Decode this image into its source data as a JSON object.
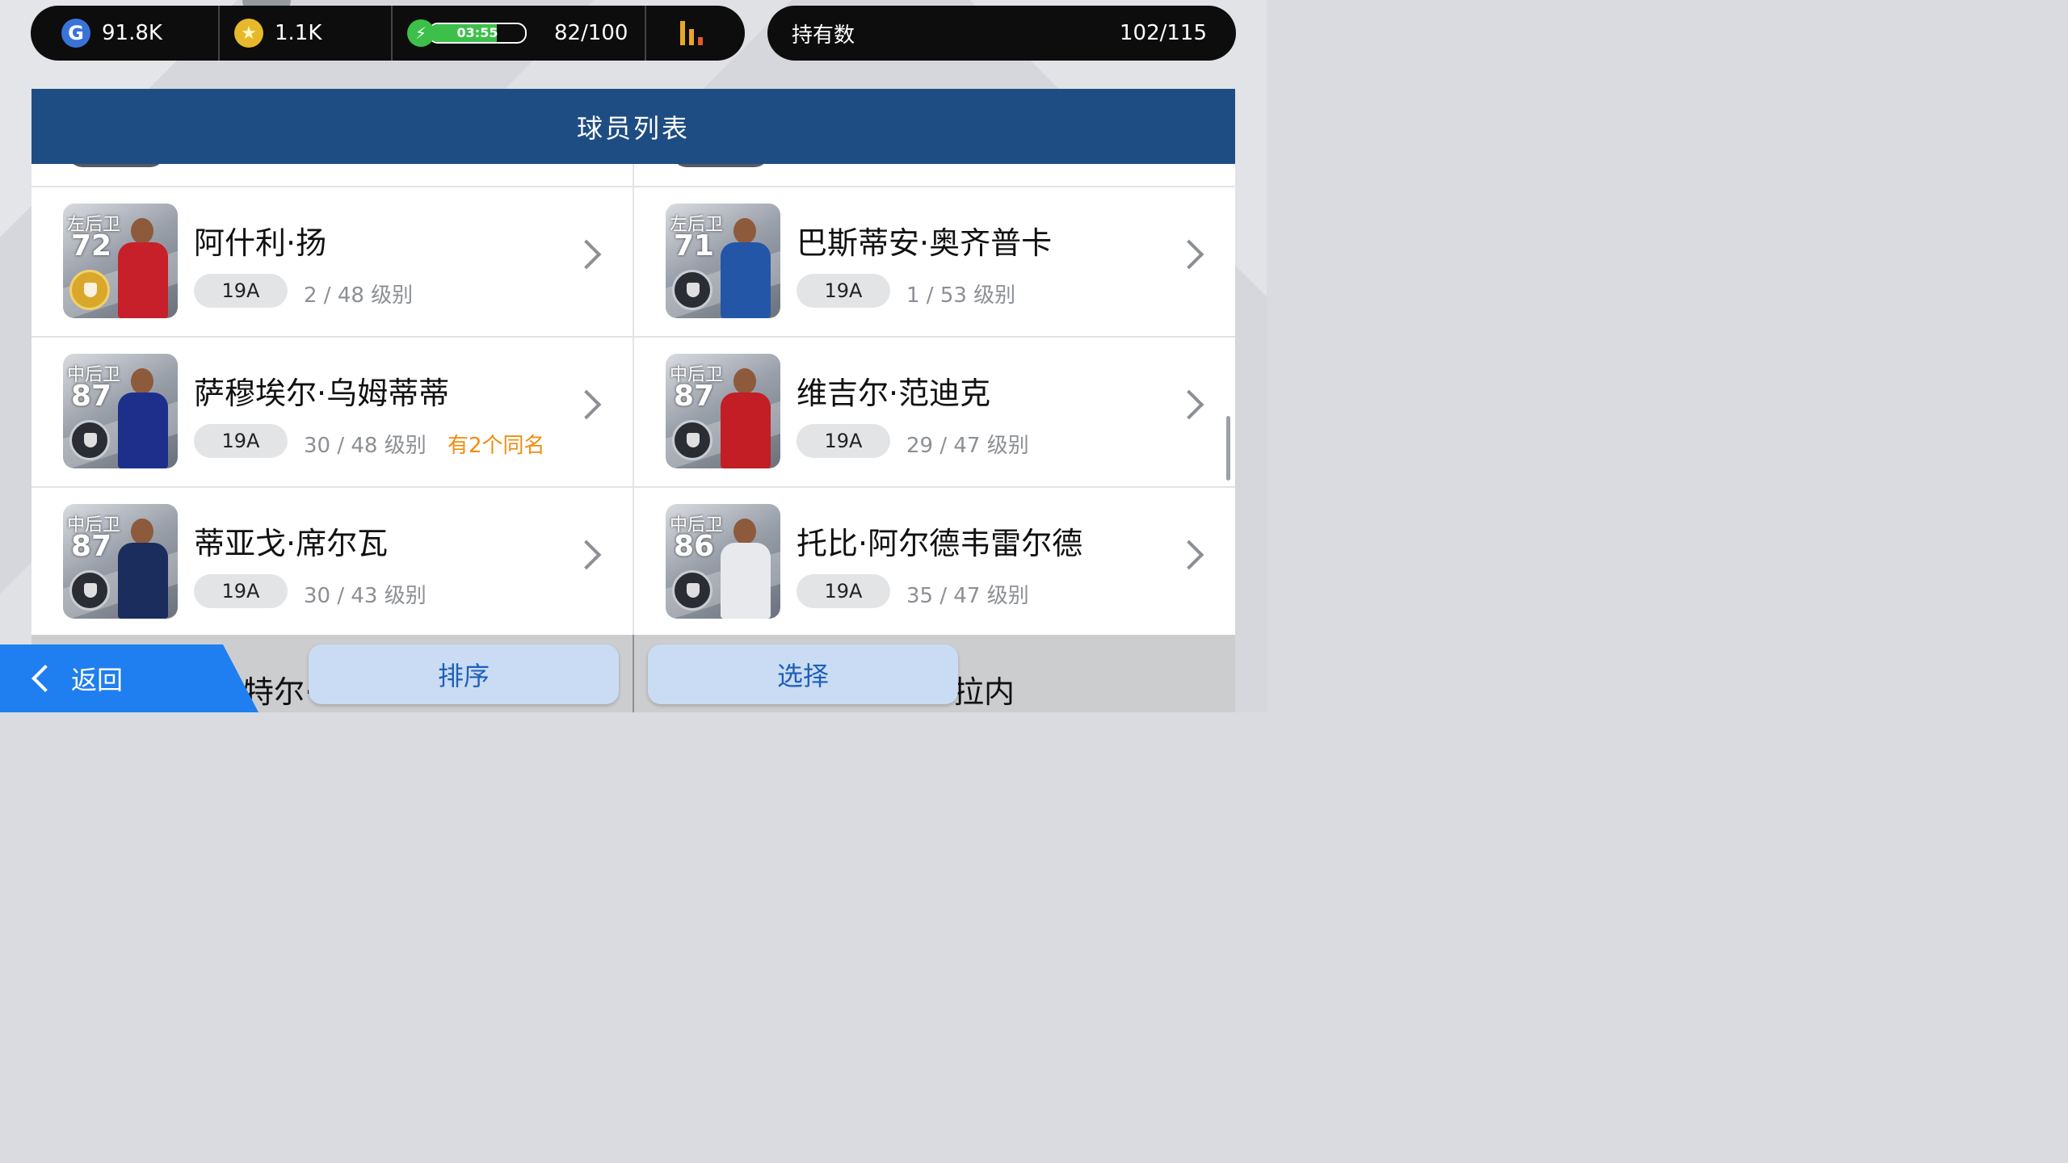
{
  "status": {
    "gp_value": "91.8K",
    "gp_icon": "G",
    "coin_value": "1.1K",
    "coin_icon": "★",
    "energy_timer": "03:55",
    "energy_fill": 0.7,
    "energy_count": "82/100",
    "owned_label": "持有数",
    "owned_value": "102/115"
  },
  "header": {
    "title": "球员列表"
  },
  "players": [
    {
      "position": "左后卫",
      "rating": "72",
      "name": "阿什利·扬",
      "tag": "19A",
      "level": "2 / 48 级别",
      "dup": "",
      "kit": "#c8202a",
      "badge": "gold"
    },
    {
      "position": "左后卫",
      "rating": "71",
      "name": "巴斯蒂安·奥齐普卡",
      "tag": "19A",
      "level": "1 / 53 级别",
      "dup": "",
      "kit": "#2456a8",
      "badge": "silver"
    },
    {
      "position": "中后卫",
      "rating": "87",
      "name": "萨穆埃尔·乌姆蒂蒂",
      "tag": "19A",
      "level": "30 / 48 级别",
      "dup": "有2个同名",
      "kit": "#1d2f8a",
      "badge": "black"
    },
    {
      "position": "中后卫",
      "rating": "87",
      "name": "维吉尔·范迪克",
      "tag": "19A",
      "level": "29 / 47 级别",
      "dup": "",
      "kit": "#c31d25",
      "badge": "black"
    },
    {
      "position": "中后卫",
      "rating": "87",
      "name": "蒂亚戈·席尔瓦",
      "tag": "19A",
      "level": "30 / 43 级别",
      "dup": "",
      "kit": "#1a2d5c",
      "badge": "black"
    },
    {
      "position": "中后卫",
      "rating": "86",
      "name": "托比·阿尔德韦雷尔德",
      "tag": "19A",
      "level": "35 / 47 级别",
      "dup": "",
      "kit": "#e8e9ec",
      "badge": "black"
    }
  ],
  "partial_names": {
    "left": "特尔·",
    "right": "拉内"
  },
  "buttons": {
    "back": "返回",
    "sort": "排序",
    "select": "选择"
  }
}
